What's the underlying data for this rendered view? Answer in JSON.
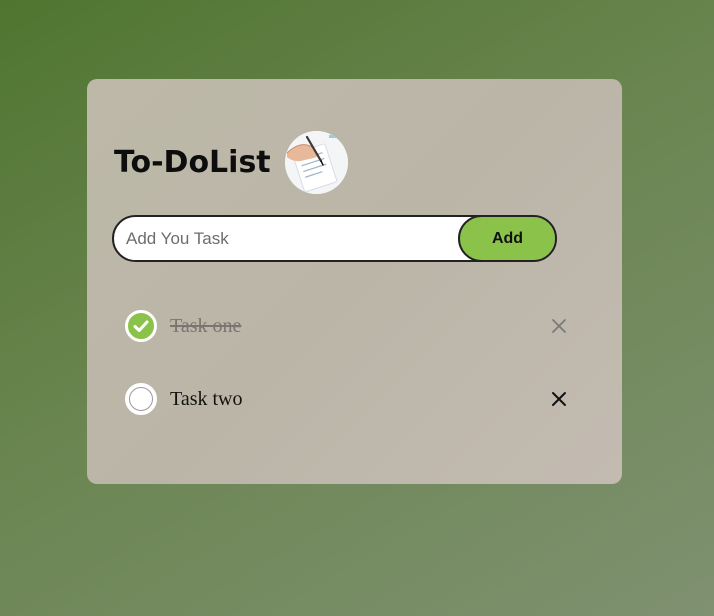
{
  "header": {
    "title": "To-DoList",
    "logo_icon": "checklist-writing-hand-icon"
  },
  "form": {
    "placeholder": "Add You Task",
    "value": "",
    "add_label": "Add"
  },
  "tasks": [
    {
      "label": "Task one",
      "completed": true
    },
    {
      "label": "Task two",
      "completed": false
    }
  ],
  "colors": {
    "accent": "#8bc34a",
    "card": "#bbb7a9",
    "background": "#5f7d42"
  }
}
